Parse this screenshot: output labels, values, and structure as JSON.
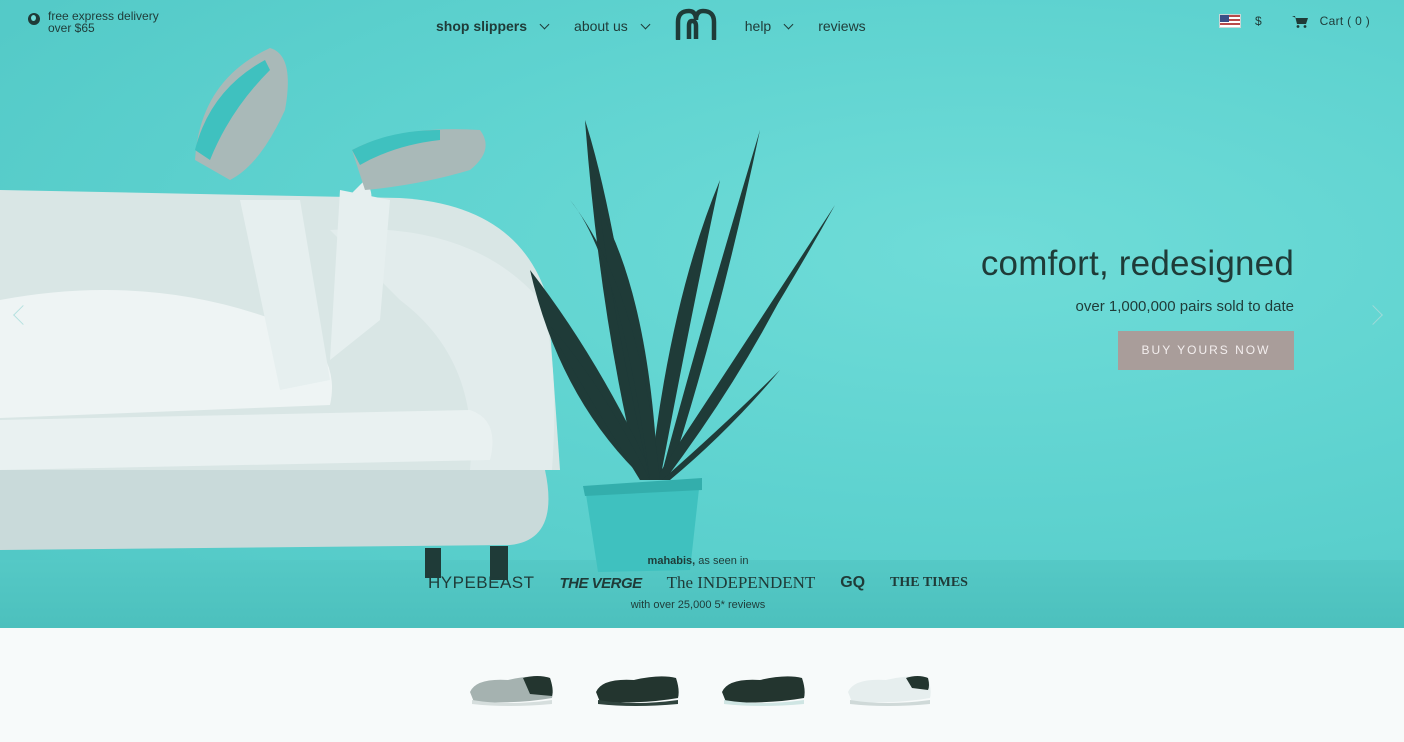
{
  "header": {
    "delivery_text": "free express delivery over $65",
    "nav": {
      "shop": "shop slippers",
      "about": "about us",
      "help": "help",
      "reviews": "reviews"
    },
    "currency": "$",
    "cart_label": "Cart ( 0 )"
  },
  "hero": {
    "title": "comfort, redesigned",
    "subtitle": "over 1,000,000 pairs sold to date",
    "cta": "BUY YOURS NOW"
  },
  "press": {
    "brand": "mahabis,",
    "as_seen_in": "as seen in",
    "logos": [
      "HYPEBEAST",
      "THE VERGE",
      "The INDEPENDENT",
      "GQ",
      "THE TIMES"
    ],
    "reviews_text": "with over 25,000 5* reviews"
  },
  "colors": {
    "hero_bg": "#5fd3d0",
    "text_dark": "#1f3b38",
    "cta_bg": "#a99d9a"
  },
  "products": [
    {
      "name": "grey-slipper"
    },
    {
      "name": "black-slipper"
    },
    {
      "name": "dark-slipper"
    },
    {
      "name": "white-slipper"
    }
  ]
}
